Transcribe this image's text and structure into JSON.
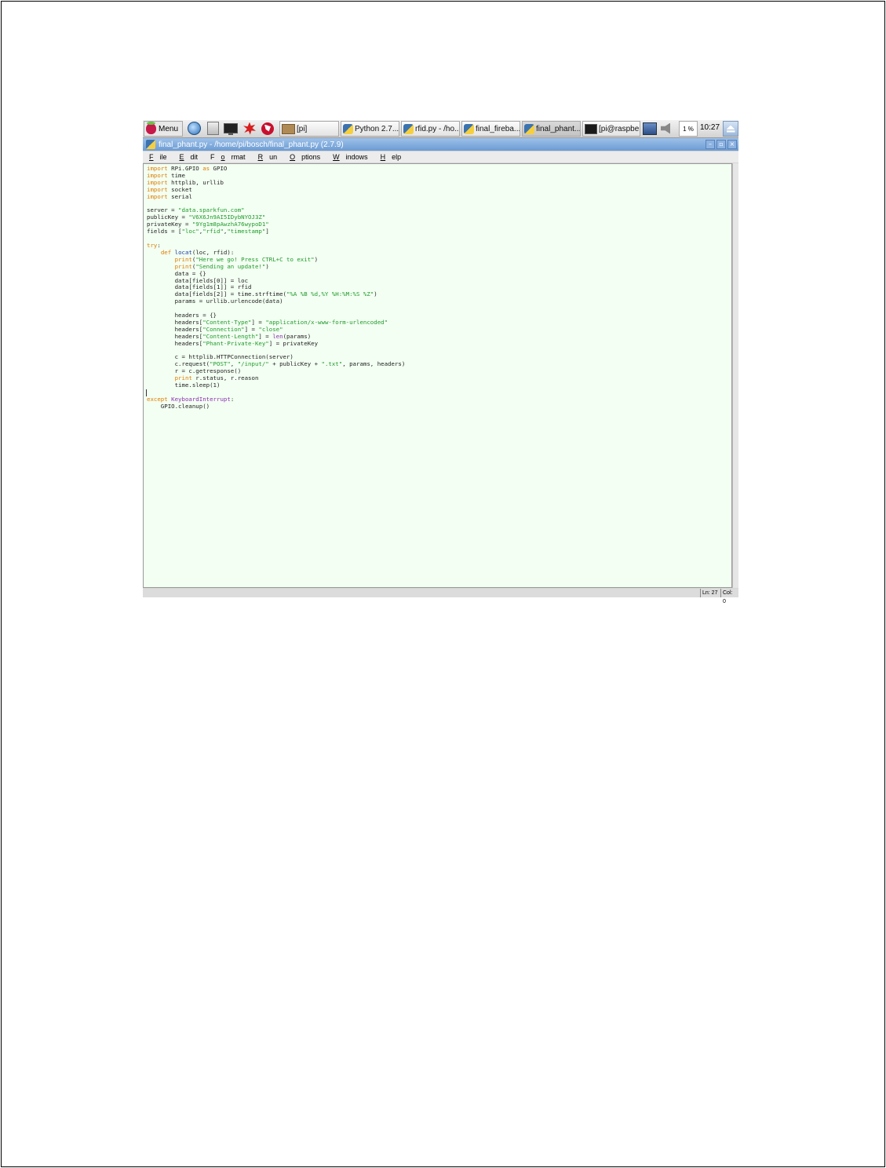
{
  "taskbar": {
    "menu_label": "Menu",
    "tasks": [
      {
        "label": "[pi]",
        "icon": "folder-icon"
      },
      {
        "label": "Python 2.7...",
        "icon": "python-icon"
      },
      {
        "label": "rfid.py - /ho...",
        "icon": "python-icon"
      },
      {
        "label": "final_fireba...",
        "icon": "python-icon"
      },
      {
        "label": "final_phant...",
        "icon": "python-icon",
        "active": true
      },
      {
        "label": "[pi@raspbe...",
        "icon": "terminal-icon"
      }
    ],
    "cpu": "1 %",
    "clock": "10:27"
  },
  "window": {
    "title": "final_phant.py - /home/pi/bosch/final_phant.py (2.7.9)",
    "menu": [
      "File",
      "Edit",
      "Format",
      "Run",
      "Options",
      "Windows",
      "Help"
    ]
  },
  "editor": {
    "lines": [
      "import RPi.GPIO as GPIO",
      "import time",
      "import httplib, urllib",
      "import socket",
      "import serial",
      "",
      "server = \"data.sparkfun.com\"",
      "publicKey = \"V6X6Jn9AI5IDybNYOJ3Z\"",
      "privateKey = \"9Yg1m8pAwzhA76wypoD1\"",
      "fields = [\"loc\",\"rfid\",\"timestamp\"]",
      "",
      "try:",
      "    def locat(loc, rfid):",
      "        print(\"Here we go! Press CTRL+C to exit\")",
      "        print(\"Sending an update!\")",
      "        data = {}",
      "        data[fields[0]] = loc",
      "        data[fields[1]] = rfid",
      "        data[fields[2]] = time.strftime(\"%A %B %d,%Y %H:%M:%S %Z\")",
      "        params = urllib.urlencode(data)",
      "",
      "        headers = {}",
      "        headers[\"Content-Type\"] = \"application/x-www-form-urlencoded\"",
      "        headers[\"Connection\"] = \"close\"",
      "        headers[\"Content-Length\"] = len(params)",
      "        headers[\"Phant-Private-Key\"] = privateKey",
      "",
      "        c = httplib.HTTPConnection(server)",
      "        c.request(\"POST\", \"/input/\" + publicKey + \".txt\", params, headers)",
      "        r = c.getresponse()",
      "        print r.status, r.reason",
      "        time.sleep(1)",
      "",
      "except KeyboardInterrupt:",
      "    GPIO.cleanup()"
    ]
  },
  "status": {
    "line": "Ln: 27",
    "col": "Col: 0"
  }
}
